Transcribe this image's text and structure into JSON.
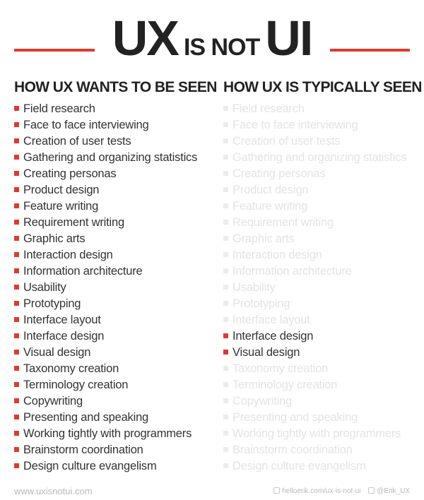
{
  "header": {
    "title_part1": "UX",
    "title_part2": "IS NOT",
    "title_part3": "UI",
    "accent_color": "#e03a2f"
  },
  "columns": [
    {
      "heading": "HOW UX WANTS TO BE SEEN",
      "items": [
        {
          "label": "Field research",
          "highlighted": true
        },
        {
          "label": "Face to face interviewing",
          "highlighted": true
        },
        {
          "label": "Creation of user tests",
          "highlighted": true
        },
        {
          "label": "Gathering and organizing statistics",
          "highlighted": true
        },
        {
          "label": "Creating personas",
          "highlighted": true
        },
        {
          "label": "Product design",
          "highlighted": true
        },
        {
          "label": "Feature writing",
          "highlighted": true
        },
        {
          "label": "Requirement writing",
          "highlighted": true
        },
        {
          "label": "Graphic arts",
          "highlighted": true
        },
        {
          "label": "Interaction design",
          "highlighted": true
        },
        {
          "label": "Information architecture",
          "highlighted": true
        },
        {
          "label": "Usability",
          "highlighted": true
        },
        {
          "label": "Prototyping",
          "highlighted": true
        },
        {
          "label": "Interface layout",
          "highlighted": true
        },
        {
          "label": "Interface design",
          "highlighted": true
        },
        {
          "label": "Visual design",
          "highlighted": true
        },
        {
          "label": "Taxonomy creation",
          "highlighted": true
        },
        {
          "label": "Terminology creation",
          "highlighted": true
        },
        {
          "label": "Copywriting",
          "highlighted": true
        },
        {
          "label": "Presenting and speaking",
          "highlighted": true
        },
        {
          "label": "Working tightly with programmers",
          "highlighted": true
        },
        {
          "label": "Brainstorm coordination",
          "highlighted": true
        },
        {
          "label": "Design culture evangelism",
          "highlighted": true
        }
      ]
    },
    {
      "heading": "HOW UX IS TYPICALLY SEEN",
      "items": [
        {
          "label": "Field research",
          "highlighted": false
        },
        {
          "label": "Face to face interviewing",
          "highlighted": false
        },
        {
          "label": "Creation of user tests",
          "highlighted": false
        },
        {
          "label": "Gathering and organizing statistics",
          "highlighted": false
        },
        {
          "label": "Creating personas",
          "highlighted": false
        },
        {
          "label": "Product design",
          "highlighted": false
        },
        {
          "label": "Feature writing",
          "highlighted": false
        },
        {
          "label": "Requirement writing",
          "highlighted": false
        },
        {
          "label": "Graphic arts",
          "highlighted": false
        },
        {
          "label": "Interaction design",
          "highlighted": false
        },
        {
          "label": "Information architecture",
          "highlighted": false
        },
        {
          "label": "Usability",
          "highlighted": false
        },
        {
          "label": "Prototyping",
          "highlighted": false
        },
        {
          "label": "Interface layout",
          "highlighted": false
        },
        {
          "label": "Interface design",
          "highlighted": true
        },
        {
          "label": "Visual design",
          "highlighted": true
        },
        {
          "label": "Taxonomy creation",
          "highlighted": false
        },
        {
          "label": "Terminology creation",
          "highlighted": false
        },
        {
          "label": "Copywriting",
          "highlighted": false
        },
        {
          "label": "Presenting and speaking",
          "highlighted": false
        },
        {
          "label": "Working tightly with programmers",
          "highlighted": false
        },
        {
          "label": "Brainstorm coordination",
          "highlighted": false
        },
        {
          "label": "Design culture evangelism",
          "highlighted": false
        }
      ]
    }
  ],
  "footer": {
    "site": "www.uxisnotui.com",
    "credit_url": "helloerik.com/ux-is-not-ui",
    "credit_url_icon": "link-icon",
    "credit_handle": "@Erik_UX",
    "credit_handle_icon": "twitter-icon"
  }
}
